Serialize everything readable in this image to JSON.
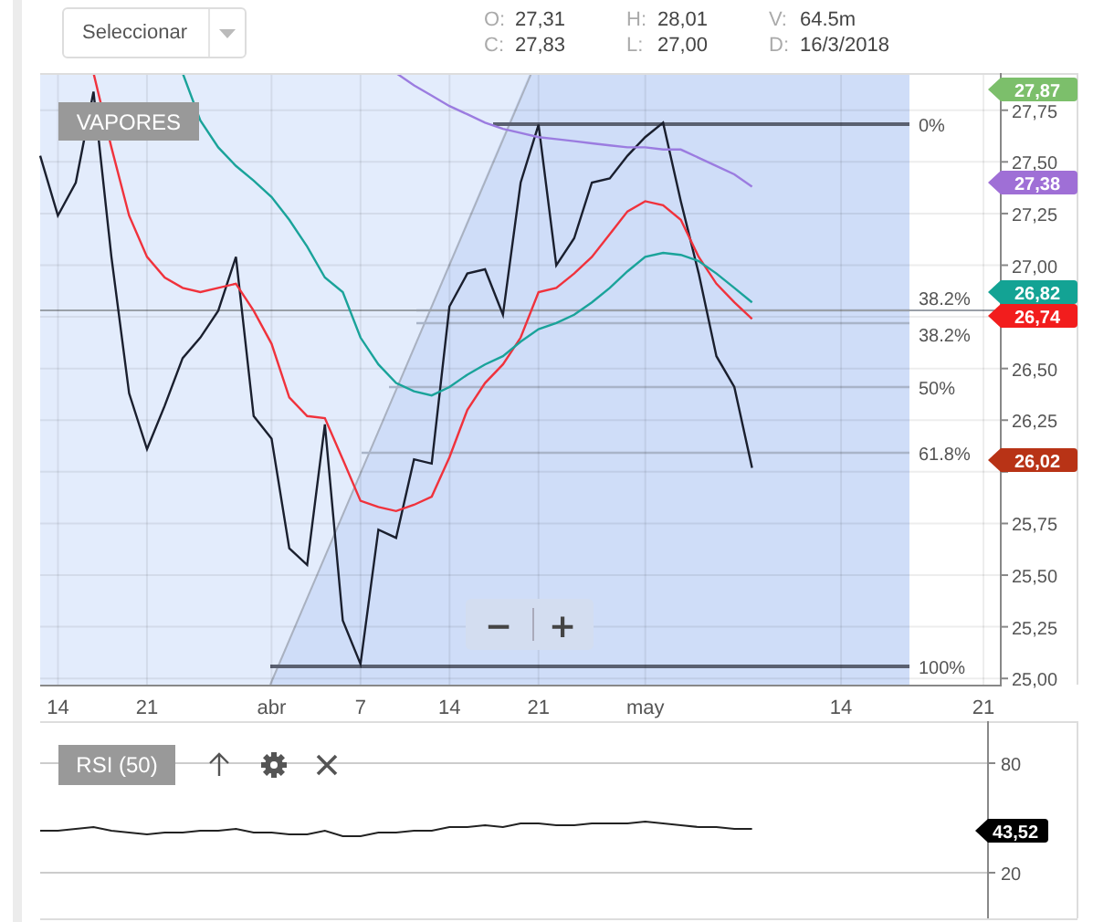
{
  "header": {
    "symbol_select": {
      "placeholder": "Seleccionar"
    },
    "ohlc": [
      {
        "label": "O:",
        "value": "27,31"
      },
      {
        "label": "H:",
        "value": "28,01"
      },
      {
        "label": "V:",
        "value": "64.5m"
      },
      {
        "label": "C:",
        "value": "27,83"
      },
      {
        "label": "L:",
        "value": "27,00"
      },
      {
        "label": "D:",
        "value": "16/3/2018"
      }
    ]
  },
  "main_chart": {
    "symbol": "VAPORES",
    "zoom_buttons": [
      "−",
      "+"
    ],
    "fibonacci_levels": [
      "0%",
      "38.2%",
      "38.2%",
      "50%",
      "61.8%",
      "100%"
    ],
    "price_tags": [
      {
        "value": "27,87",
        "color": "#7cbf6b"
      },
      {
        "value": "27,38",
        "color": "#9f6fd6"
      },
      {
        "value": "26,82",
        "color": "#13a394"
      },
      {
        "value": "26,74",
        "color": "#f21d1d"
      },
      {
        "value": "26,02",
        "color": "#b83316"
      }
    ],
    "chart_data": {
      "type": "line",
      "grid": true,
      "categories": [
        null,
        "14",
        null,
        null,
        null,
        null,
        "21",
        null,
        null,
        null,
        null,
        null,
        null,
        "abr",
        null,
        null,
        null,
        null,
        "7",
        null,
        null,
        null,
        null,
        "14",
        null,
        null,
        null,
        null,
        "21",
        null,
        null,
        null,
        null,
        null,
        "may",
        null,
        null,
        null,
        null,
        null,
        null,
        null,
        null,
        null,
        null,
        "14",
        null,
        null,
        null,
        null,
        null,
        null,
        null,
        "21",
        null
      ],
      "ylim": [
        24.97,
        27.93
      ],
      "yticks": [
        {
          "value": 27.75,
          "label": "27,75"
        },
        {
          "value": 27.5,
          "label": "27,50"
        },
        {
          "value": 27.25,
          "label": "27,25"
        },
        {
          "value": 27,
          "label": "27,00"
        },
        {
          "value": 26.5,
          "label": "26,50"
        },
        {
          "value": 26.25,
          "label": "26,25"
        },
        {
          "value": 25.75,
          "label": "25,75"
        },
        {
          "value": 25.5,
          "label": "25,50"
        },
        {
          "value": 25.25,
          "label": "25,25"
        },
        {
          "value": 25,
          "label": "25,00"
        }
      ],
      "series": [
        {
          "color": "#1a1f2e",
          "values": [
            27.53,
            27.24,
            27.4,
            27.84,
            27.04,
            26.38,
            26.11,
            26.32,
            26.55,
            26.65,
            26.78,
            27.04,
            26.27,
            26.16,
            25.63,
            25.55,
            26.23,
            25.28,
            25.07,
            25.72,
            25.68,
            26.06,
            26.04,
            26.8,
            26.96,
            26.98,
            26.76,
            27.4,
            27.68,
            27,
            27.13,
            27.4,
            27.42,
            27.53,
            27.62,
            27.69,
            27.31,
            26.96,
            26.56,
            26.41,
            26.02,
            null,
            null,
            null,
            null,
            null,
            null,
            null,
            null,
            null,
            null,
            null,
            null,
            null,
            null
          ]
        },
        {
          "color": "#f0323c",
          "values": [
            null,
            null,
            null,
            27.93,
            27.57,
            27.24,
            27.04,
            26.94,
            26.89,
            26.87,
            26.89,
            26.91,
            26.78,
            26.62,
            26.36,
            26.27,
            26.26,
            26.06,
            25.86,
            25.83,
            25.81,
            25.84,
            25.88,
            26.07,
            26.3,
            26.43,
            26.52,
            26.65,
            26.87,
            26.89,
            26.96,
            27.04,
            27.15,
            27.26,
            27.31,
            27.29,
            27.22,
            27.04,
            26.91,
            26.82,
            26.74,
            null,
            null,
            null,
            null,
            null,
            null,
            null,
            null,
            null,
            null,
            null,
            null,
            null,
            null
          ]
        },
        {
          "color": "#1aa39a",
          "values": [
            null,
            null,
            null,
            null,
            null,
            null,
            null,
            null,
            27.93,
            27.7,
            27.57,
            27.48,
            27.41,
            27.33,
            27.22,
            27.09,
            26.94,
            26.87,
            26.65,
            26.52,
            26.43,
            26.39,
            26.37,
            26.41,
            26.47,
            26.52,
            26.56,
            26.63,
            26.69,
            26.72,
            26.76,
            26.82,
            26.89,
            26.97,
            27.04,
            27.06,
            27.05,
            27.02,
            26.96,
            26.89,
            26.82,
            null,
            null,
            null,
            null,
            null,
            null,
            null,
            null,
            null,
            null,
            null,
            null,
            null,
            null
          ]
        },
        {
          "color": "#9b7ce0",
          "values": [
            null,
            null,
            null,
            null,
            null,
            null,
            null,
            null,
            null,
            null,
            null,
            null,
            null,
            null,
            null,
            null,
            null,
            null,
            null,
            null,
            27.93,
            27.87,
            27.82,
            27.77,
            27.73,
            27.69,
            27.66,
            27.64,
            27.62,
            27.61,
            27.6,
            27.59,
            27.58,
            27.57,
            27.57,
            27.56,
            27.56,
            27.52,
            27.48,
            27.44,
            27.38,
            null,
            null,
            null,
            null,
            null,
            null,
            null,
            null,
            null,
            null,
            null,
            null,
            null,
            null
          ]
        }
      ]
    }
  },
  "rsi_panel": {
    "title": "RSI (50)",
    "value_tag": "43,52",
    "chart_data": {
      "type": "line",
      "categories": [
        null,
        null,
        null,
        null,
        null,
        null,
        null,
        null,
        null,
        null,
        null,
        null,
        null,
        null,
        null,
        null,
        null,
        null,
        null,
        null,
        null,
        null,
        null,
        null,
        null,
        null,
        null,
        null,
        null,
        null,
        null,
        null,
        null,
        null,
        null,
        null,
        null,
        null,
        null,
        null,
        null,
        null,
        null,
        null,
        null,
        null,
        null,
        null,
        null,
        null,
        null,
        null,
        null,
        null,
        null
      ],
      "ylim": [
        -5,
        103
      ],
      "yticks": [
        20,
        80
      ],
      "series": [
        {
          "color": "#222222",
          "values": [
            43,
            43,
            44,
            45,
            43,
            42,
            41,
            42,
            42,
            43,
            43,
            44,
            42,
            42,
            41,
            41,
            43,
            40,
            40,
            42,
            42,
            43,
            43,
            45,
            45,
            46,
            45,
            47,
            47,
            46,
            46,
            47,
            47,
            47,
            48,
            47,
            46,
            45,
            45,
            44,
            44,
            null,
            null,
            null,
            null,
            null,
            null,
            null,
            null,
            null,
            null,
            null,
            null,
            null,
            null
          ]
        }
      ]
    }
  }
}
